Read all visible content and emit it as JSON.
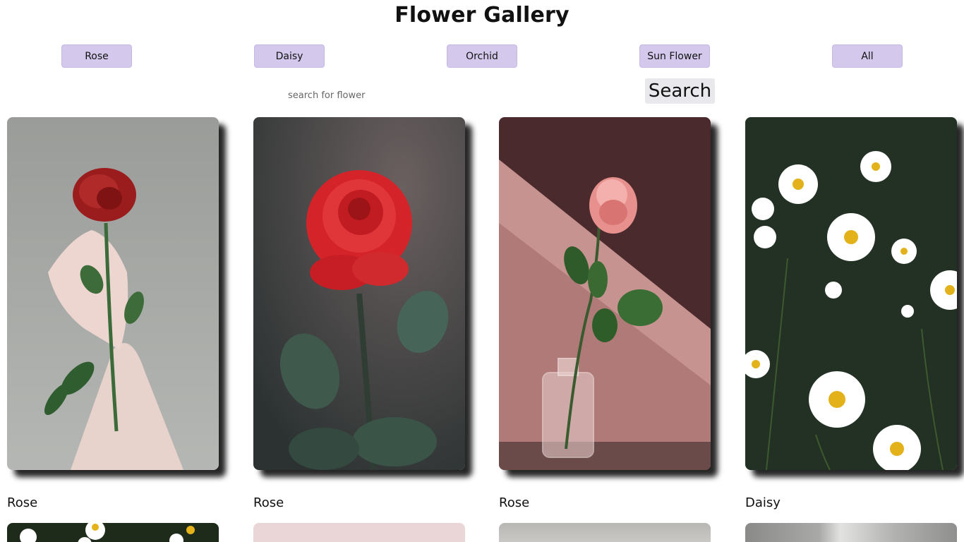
{
  "header": {
    "title": "Flower Gallery"
  },
  "filters": [
    {
      "label": "Rose"
    },
    {
      "label": "Daisy"
    },
    {
      "label": "Orchid"
    },
    {
      "label": "Sun Flower"
    },
    {
      "label": "All"
    }
  ],
  "search": {
    "placeholder": "search for flower",
    "button_label": "Search"
  },
  "gallery": {
    "cards": [
      {
        "caption": "Rose",
        "image": "rose-in-hand-photo"
      },
      {
        "caption": "Rose",
        "image": "red-rose-raindrops-photo"
      },
      {
        "caption": "Rose",
        "image": "pink-rose-in-vase-photo"
      },
      {
        "caption": "Daisy",
        "image": "daisy-field-photo"
      }
    ],
    "next_row_images": [
      "white-flowers-photo",
      "pink-background-photo",
      "grey-photo",
      "grey-wall-photo"
    ]
  }
}
